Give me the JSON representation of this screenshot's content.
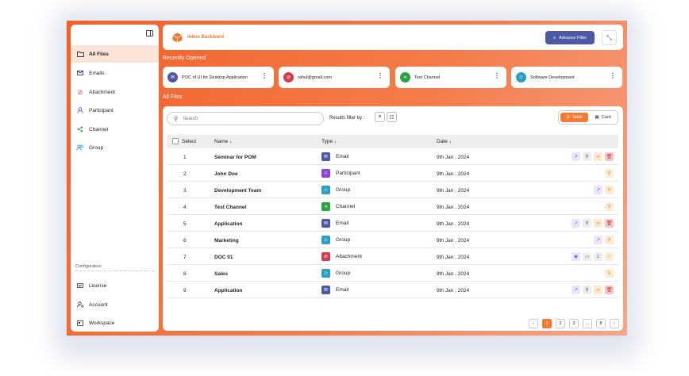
{
  "app": {
    "title": "Inbox Backward",
    "advance_filter": "Advance Filter"
  },
  "sidebar": {
    "items": [
      {
        "label": "All Files",
        "icon": "folder-icon"
      },
      {
        "label": "Emails",
        "icon": "mail-icon"
      },
      {
        "label": "Attachment",
        "icon": "paperclip-icon"
      },
      {
        "label": "Participant",
        "icon": "user-icon"
      },
      {
        "label": "Channel",
        "icon": "share-icon"
      },
      {
        "label": "Group",
        "icon": "users-icon"
      }
    ],
    "config_title": "Configuration",
    "config_items": [
      {
        "label": "License",
        "icon": "license-icon"
      },
      {
        "label": "Account",
        "icon": "user-gear-icon"
      },
      {
        "label": "Workspace",
        "icon": "workspace-icon"
      }
    ]
  },
  "recent": {
    "title": "Recently Opened",
    "items": [
      {
        "name": "POC of UI for Desktop Application",
        "color": "#4d5aa3",
        "icon": "mail-icon"
      },
      {
        "name": "rahul@gmail.com",
        "color": "#d23c4e",
        "icon": "paperclip-icon"
      },
      {
        "name": "Test Channel",
        "color": "#27a343",
        "icon": "share-icon"
      },
      {
        "name": "Software Development",
        "color": "#2a9fc4",
        "icon": "users-icon"
      }
    ]
  },
  "all_files": {
    "title": "All Files",
    "search_placeholder": "Search",
    "filter_label": "Results filter by :",
    "view_table": "Table",
    "view_card": "Card",
    "columns": {
      "select": "Select",
      "name": "Name ↓",
      "type": "Type ↓",
      "date": "Date ↓"
    },
    "rows": [
      {
        "num": "1",
        "name": "Seminar for POM",
        "type": "Email",
        "date": "9th Jan , 2024"
      },
      {
        "num": "2",
        "name": "John Doe",
        "type": "Participant",
        "date": "9th Jan , 2024"
      },
      {
        "num": "3",
        "name": "Development Team",
        "type": "Group",
        "date": "9th Jan , 2024"
      },
      {
        "num": "4",
        "name": "Test Channel",
        "type": "Channel",
        "date": "9th Jan , 2024"
      },
      {
        "num": "5",
        "name": "Application",
        "type": "Email",
        "date": "9th Jan , 2024"
      },
      {
        "num": "6",
        "name": "Marketing",
        "type": "Group",
        "date": "9th Jan , 2024"
      },
      {
        "num": "7",
        "name": "DOC 01",
        "type": "Attachment",
        "date": "9th Jan , 2024"
      },
      {
        "num": "8",
        "name": "Sales",
        "type": "Group",
        "date": "9th Jan , 2024"
      },
      {
        "num": "9",
        "name": "Application",
        "type": "Email",
        "date": "9th Jan , 2024"
      }
    ]
  },
  "type_colors": {
    "Email": "#4d5aa3",
    "Participant": "#8b45d6",
    "Group": "#2a9fc4",
    "Channel": "#27a343",
    "Attachment": "#d23c4e"
  },
  "pagination": {
    "pages": [
      "1",
      "2",
      "3",
      "...",
      "8"
    ],
    "current": "1"
  }
}
